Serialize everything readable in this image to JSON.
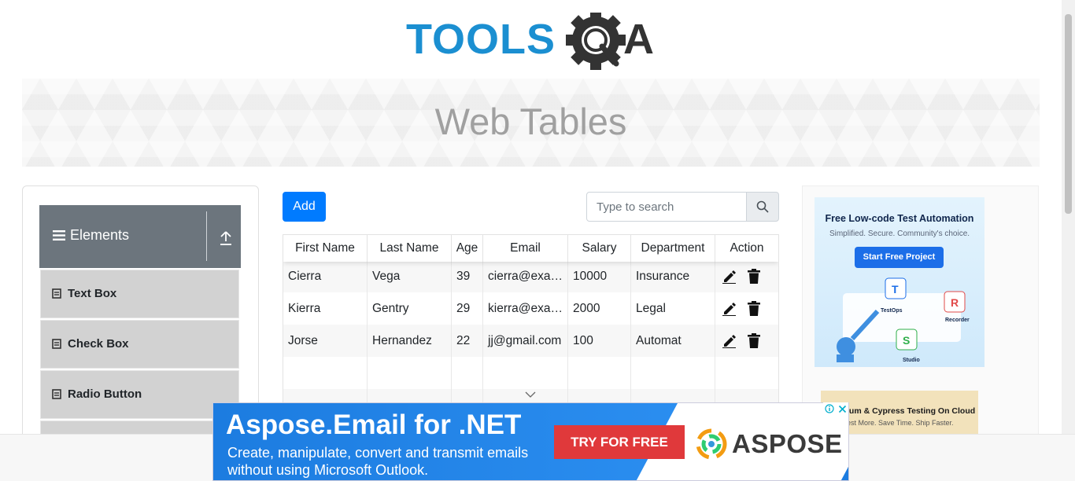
{
  "header": {
    "logo_text_left": "TOOLS",
    "logo_text_right": "A",
    "page_title": "Web Tables"
  },
  "sidebar": {
    "group_title": "Elements",
    "items": [
      {
        "label": "Text Box"
      },
      {
        "label": "Check Box"
      },
      {
        "label": "Radio Button"
      }
    ]
  },
  "toolbar": {
    "add_label": "Add",
    "search_placeholder": "Type to search"
  },
  "table": {
    "columns": [
      "First Name",
      "Last Name",
      "Age",
      "Email",
      "Salary",
      "Department",
      "Action"
    ],
    "rows": [
      [
        "Cierra",
        "Vega",
        "39",
        "cierra@example.com",
        "10000",
        "Insurance"
      ],
      [
        "Kierra",
        "Gentry",
        "29",
        "kierra@example.com",
        "2000",
        "Legal"
      ],
      [
        "Jorse",
        "Hernandez",
        "22",
        "jj@gmail.com",
        "100",
        "Automat"
      ]
    ]
  },
  "side_ad": {
    "headline": "Free Low-code Test Automation",
    "subline": "Simplified. Secure. Community's choice.",
    "cta": "Start Free Project",
    "tag1": "TestOps",
    "tag2": "Recorder",
    "tag3": "Studio",
    "ad2_headline": "ium & Cypress Testing On Cloud",
    "ad2_subline": "est More. Save Time. Ship Faster."
  },
  "bottom_ad": {
    "title": "Aspose.Email for .NET",
    "line1": "Create, manipulate, convert and transmit emails",
    "line2": "without using Microsoft Outlook.",
    "cta": "TRY FOR FREE",
    "brand": "ASPOSE"
  },
  "colors": {
    "primary": "#007bff",
    "logo_blue": "#1b8fd1",
    "logo_dark": "#333333",
    "menu_header": "#6c757d",
    "menu_item": "#d2d2d2",
    "ad_red": "#e0393b"
  },
  "icons": [
    "hamburger-icon",
    "upload-icon",
    "document-icon",
    "search-icon",
    "edit-icon",
    "delete-icon",
    "chevron-down-icon",
    "ad-info-icon",
    "ad-close-icon",
    "gear-icon"
  ]
}
